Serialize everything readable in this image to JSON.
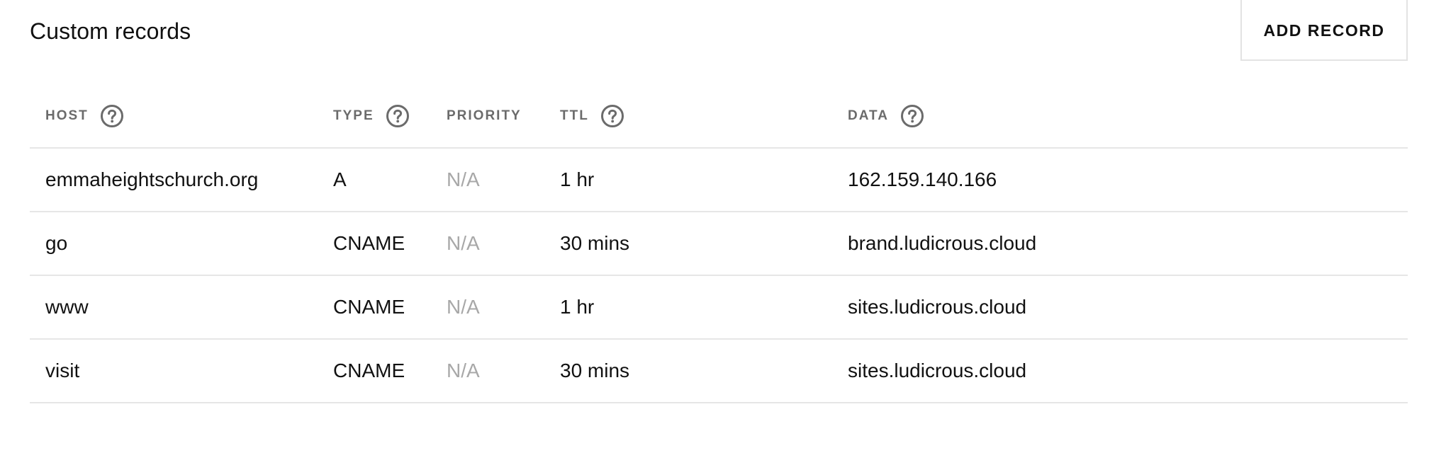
{
  "section": {
    "title": "Custom records",
    "add_button_label": "ADD RECORD"
  },
  "table": {
    "columns": [
      {
        "key": "host",
        "label": "HOST",
        "has_help": true,
        "help_icon": "question-circle-icon"
      },
      {
        "key": "type",
        "label": "TYPE",
        "has_help": true,
        "help_icon": "question-circle-icon"
      },
      {
        "key": "priority",
        "label": "PRIORITY",
        "has_help": false
      },
      {
        "key": "ttl",
        "label": "TTL",
        "has_help": true,
        "help_icon": "question-circle-icon"
      },
      {
        "key": "data",
        "label": "DATA",
        "has_help": true,
        "help_icon": "question-circle-icon"
      }
    ],
    "rows": [
      {
        "host": "emmaheightschurch.org",
        "type": "A",
        "priority": "N/A",
        "ttl": "1 hr",
        "data": "162.159.140.166"
      },
      {
        "host": "go",
        "type": "CNAME",
        "priority": "N/A",
        "ttl": "30 mins",
        "data": "brand.ludicrous.cloud"
      },
      {
        "host": "www",
        "type": "CNAME",
        "priority": "N/A",
        "ttl": "1 hr",
        "data": "sites.ludicrous.cloud"
      },
      {
        "host": "visit",
        "type": "CNAME",
        "priority": "N/A",
        "ttl": "30 mins",
        "data": "sites.ludicrous.cloud"
      }
    ]
  },
  "colors": {
    "text": "#111111",
    "header_text": "#6b6b6b",
    "muted_text": "#a8a8a8",
    "divider": "#e6e6e6",
    "button_border": "#e3e3e3",
    "icon": "#6b6b6b"
  }
}
